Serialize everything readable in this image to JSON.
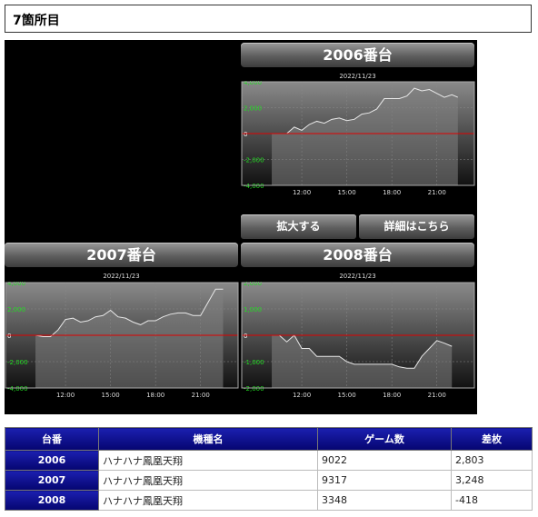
{
  "page": {
    "heading": "7箇所目"
  },
  "panels": [
    {
      "title": "2006番台",
      "date": "2022/11/23",
      "chart_data": {
        "type": "area",
        "ylim": [
          -4000,
          4000
        ],
        "yticks": [
          "4,000",
          "2,000",
          "0",
          "-2,000",
          "-4,000"
        ],
        "xticks": [
          "12:00",
          "15:00",
          "18:00",
          "21:00"
        ],
        "x": [
          0,
          0.5,
          1.0,
          1.5,
          2.0,
          2.5,
          3.0,
          3.5,
          4.0,
          4.5,
          5.0,
          5.5,
          6.0,
          6.5,
          7.0,
          7.5,
          8.0,
          8.5,
          9.0,
          9.5,
          10.0,
          10.5,
          11.0,
          11.5,
          12.0,
          12.4
        ],
        "values": [
          0,
          0,
          0,
          500,
          250,
          700,
          950,
          800,
          1100,
          1200,
          1000,
          1100,
          1500,
          1600,
          1900,
          2700,
          2700,
          2700,
          2900,
          3500,
          3300,
          3400,
          3100,
          2800,
          3000,
          2800
        ]
      }
    },
    {
      "title": "2007番台",
      "date": "2022/11/23",
      "chart_data": {
        "type": "area",
        "ylim": [
          -4000,
          4000
        ],
        "yticks": [
          "4,000",
          "2,000",
          "0",
          "-2,000",
          "-4,000"
        ],
        "xticks": [
          "12:00",
          "15:00",
          "18:00",
          "21:00"
        ],
        "x": [
          0,
          0.5,
          1.0,
          1.5,
          2.0,
          2.5,
          3.0,
          3.5,
          4.0,
          4.5,
          5.0,
          5.5,
          6.0,
          6.5,
          7.0,
          7.5,
          8.0,
          8.5,
          9.0,
          9.5,
          10.0,
          10.5,
          11.0,
          11.5,
          12.0,
          12.5
        ],
        "values": [
          0,
          -100,
          -100,
          400,
          1200,
          1300,
          1000,
          1100,
          1400,
          1500,
          1900,
          1400,
          1300,
          1000,
          800,
          1100,
          1100,
          1400,
          1600,
          1700,
          1700,
          1500,
          1500,
          2500,
          3500,
          3500
        ]
      }
    },
    {
      "title": "2008番台",
      "date": "2022/11/23",
      "chart_data": {
        "type": "area",
        "ylim": [
          -2000,
          2000
        ],
        "yticks": [
          "2,000",
          "1,000",
          "0",
          "-1,000",
          "-2,000"
        ],
        "xticks": [
          "12:00",
          "15:00",
          "18:00",
          "21:00"
        ],
        "x": [
          0,
          0.5,
          1.0,
          1.5,
          2.0,
          2.5,
          3.0,
          3.5,
          4.0,
          4.5,
          5.0,
          5.5,
          6.0,
          6.5,
          7.0,
          7.5,
          8.0,
          8.5,
          9.0,
          9.5,
          10.0,
          10.5,
          11.0,
          11.5,
          12.0
        ],
        "values": [
          0,
          0,
          -250,
          0,
          -500,
          -500,
          -800,
          -800,
          -800,
          -800,
          -1000,
          -1100,
          -1100,
          -1100,
          -1100,
          -1100,
          -1100,
          -1200,
          -1250,
          -1250,
          -800,
          -500,
          -200,
          -300,
          -418
        ]
      }
    }
  ],
  "buttons": {
    "zoom": "拡大する",
    "details": "詳細はこちら"
  },
  "table": {
    "headers": [
      "台番",
      "機種名",
      "ゲーム数",
      "差枚"
    ],
    "rows": [
      {
        "id": "2006",
        "model": "ハナハナ鳳凰天翔",
        "games": "9022",
        "diff": "2,803"
      },
      {
        "id": "2007",
        "model": "ハナハナ鳳凰天翔",
        "games": "9317",
        "diff": "3,248"
      },
      {
        "id": "2008",
        "model": "ハナハナ鳳凰天翔",
        "games": "3348",
        "diff": "-418"
      }
    ]
  },
  "colors": {
    "zero_line": "#e00000",
    "positive_tick": "#22dd22",
    "negative_tick": "#22dd22",
    "table_header": "#0d0f90"
  }
}
